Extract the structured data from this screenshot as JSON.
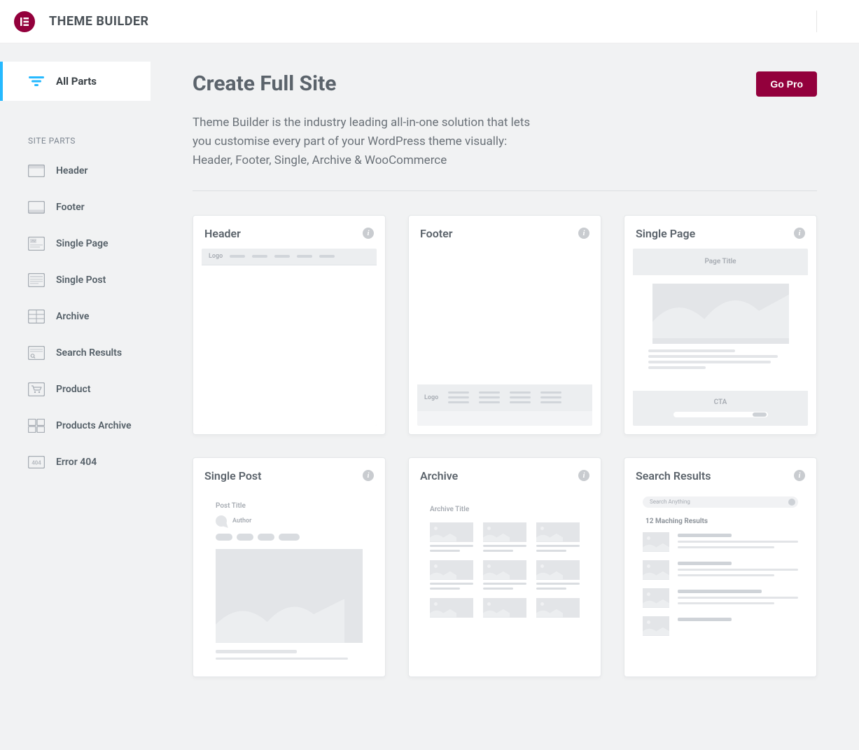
{
  "app_title": "THEME BUILDER",
  "sidebar": {
    "all_parts": "All Parts",
    "section_label": "SITE PARTS",
    "items": [
      {
        "label": "Header"
      },
      {
        "label": "Footer"
      },
      {
        "label": "Single Page"
      },
      {
        "label": "Single Post"
      },
      {
        "label": "Archive"
      },
      {
        "label": "Search Results"
      },
      {
        "label": "Product"
      },
      {
        "label": "Products Archive"
      },
      {
        "label": "Error 404"
      }
    ]
  },
  "page": {
    "title": "Create Full Site",
    "go_pro_label": "Go Pro",
    "description": "Theme Builder is the industry leading all-in-one solution that lets you customise every part of your WordPress theme visually: Header, Footer, Single, Archive & WooCommerce"
  },
  "cards": [
    {
      "title": "Header",
      "mock": {
        "logo": "Logo"
      }
    },
    {
      "title": "Footer",
      "mock": {
        "logo": "Logo"
      }
    },
    {
      "title": "Single Page",
      "mock": {
        "page_title": "Page Title",
        "cta": "CTA"
      }
    },
    {
      "title": "Single Post",
      "mock": {
        "post_title": "Post Title",
        "author": "Author"
      }
    },
    {
      "title": "Archive",
      "mock": {
        "archive_title": "Archive Title"
      }
    },
    {
      "title": "Search Results",
      "mock": {
        "search_placeholder": "Search Anything",
        "results_text": "12 Maching Results"
      }
    }
  ]
}
